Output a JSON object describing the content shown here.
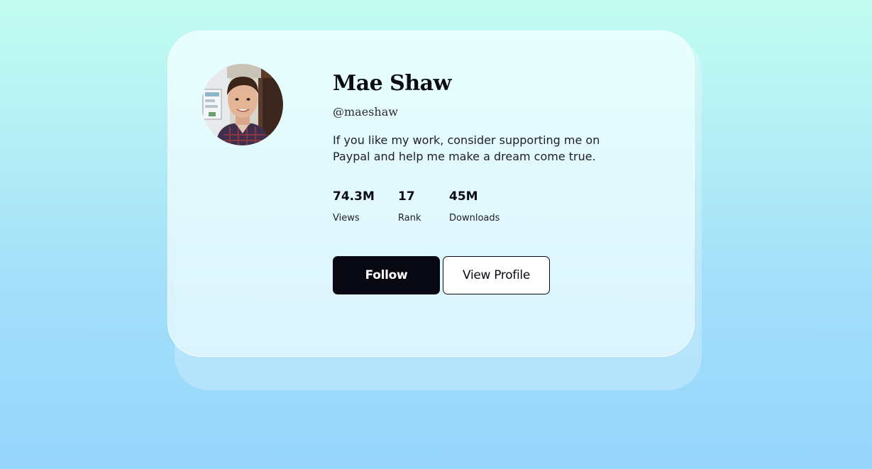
{
  "profile": {
    "name": "Mae Shaw",
    "handle": "@maeshaw",
    "bio": "If you like my work, consider supporting me on Paypal and help me make a dream come true.",
    "avatar_icon": "profile-photo"
  },
  "stats": [
    {
      "value": "74.3M",
      "label": "Views"
    },
    {
      "value": "17",
      "label": "Rank"
    },
    {
      "value": "45M",
      "label": "Downloads"
    }
  ],
  "actions": {
    "follow_label": "Follow",
    "view_profile_label": "View Profile"
  },
  "colors": {
    "background_top": "#c2fdf1",
    "background_bottom": "#97d6fd",
    "primary_button": "#080812",
    "text": "#0b0b16"
  }
}
